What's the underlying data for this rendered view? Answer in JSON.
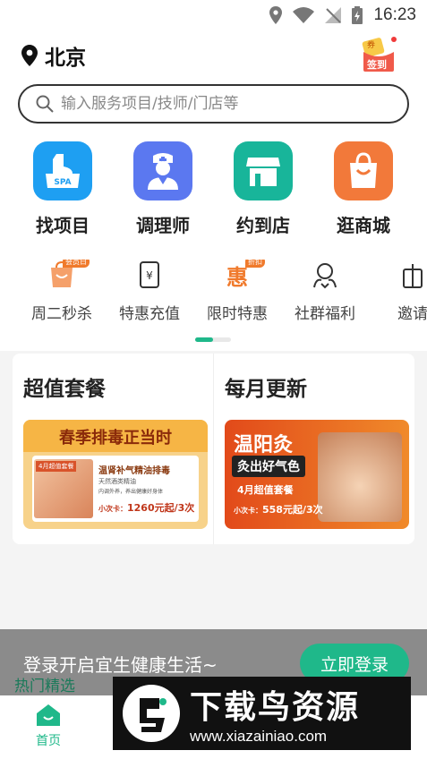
{
  "status_bar": {
    "time": "16:23"
  },
  "location": {
    "city": "北京"
  },
  "checkin": {
    "badge": "券",
    "label": "签到"
  },
  "search": {
    "placeholder": "输入服务项目/技师/门店等"
  },
  "categories": [
    {
      "label": "找项目",
      "icon": "spa-icon",
      "badge": "SPA",
      "color": "#1e9ff2"
    },
    {
      "label": "调理师",
      "icon": "nurse-icon",
      "color": "#5b78f0"
    },
    {
      "label": "约到店",
      "icon": "store-icon",
      "color": "#18b59a"
    },
    {
      "label": "逛商城",
      "icon": "shopping-bag-icon",
      "color": "#f2793a"
    }
  ],
  "sub_categories": [
    {
      "label": "周二秒杀",
      "icon": "flash-sale-icon",
      "tag": "会员日"
    },
    {
      "label": "特惠充值",
      "icon": "recharge-icon",
      "glyph": "¥"
    },
    {
      "label": "限时特惠",
      "icon": "discount-icon",
      "glyph": "惠",
      "tag": "折扣"
    },
    {
      "label": "社群福利",
      "icon": "community-icon"
    },
    {
      "label": "邀请",
      "icon": "gift-icon"
    }
  ],
  "promos": [
    {
      "title": "超值套餐",
      "banner": {
        "headline": "春季排毒正当时",
        "badge": "4月超值套餐",
        "subtitle": "温肾补气精油排毒",
        "desc": "天然酒类精油",
        "desc2": "内调外养，养出健康好身体",
        "price_prefix": "小次卡：",
        "price": "1260元起/3次"
      }
    },
    {
      "title": "每月更新",
      "banner": {
        "headline": "温阳灸",
        "sub": "灸出好气色",
        "badge": "4月超值套餐",
        "price_prefix": "小次卡：",
        "price": "558元起/3次"
      }
    }
  ],
  "login_bar": {
    "text": "登录开启宜生健康生活~",
    "button": "立即登录"
  },
  "hot_picks": "热门精选",
  "nav": {
    "home": "首页"
  },
  "watermark": {
    "title": "下载鸟资源",
    "url": "www.xiazainiao.com"
  },
  "colors": {
    "accent": "#1fb88a",
    "tag": "#f07a2c"
  }
}
